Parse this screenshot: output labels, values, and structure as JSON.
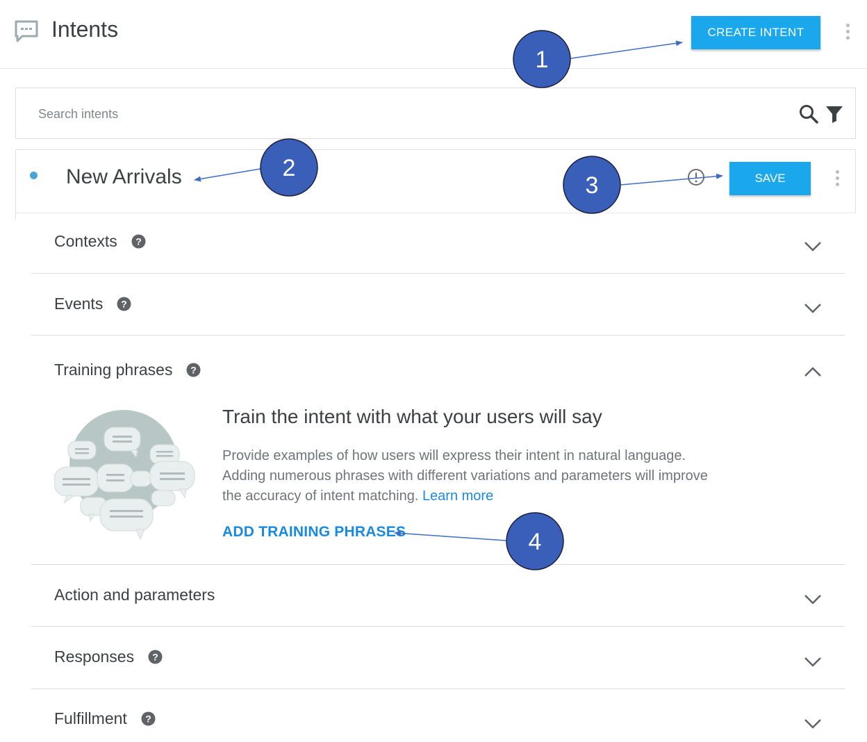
{
  "header": {
    "title": "Intents",
    "create_label": "CREATE INTENT"
  },
  "search": {
    "placeholder": "Search intents"
  },
  "intent": {
    "name": "New Arrivals",
    "save_label": "SAVE"
  },
  "sections": {
    "contexts": "Contexts",
    "events": "Events",
    "training": "Training phrases",
    "action": "Action and parameters",
    "responses": "Responses",
    "fulfillment": "Fulfillment"
  },
  "training": {
    "title": "Train the intent with what your users will say",
    "description": "Provide examples of how users will express their intent in natural language. Adding numerous phrases with different variations and parameters will improve the accuracy of intent matching.",
    "learn_more": "Learn more",
    "add_label": "ADD TRAINING PHRASES"
  },
  "annotations": [
    "1",
    "2",
    "3",
    "4"
  ],
  "colors": {
    "accent": "#1aa7ec",
    "link": "#1a8ae0",
    "annotation_fill": "#3a5fb8",
    "annotation_stroke": "#1b1f3a",
    "annotation_arrow": "#3f6cc4"
  },
  "icons": [
    "chat-logo-icon",
    "more-vert-icon",
    "search-icon",
    "filter-icon",
    "warning-icon",
    "help-icon",
    "chevron-down-icon",
    "chevron-up-icon"
  ]
}
